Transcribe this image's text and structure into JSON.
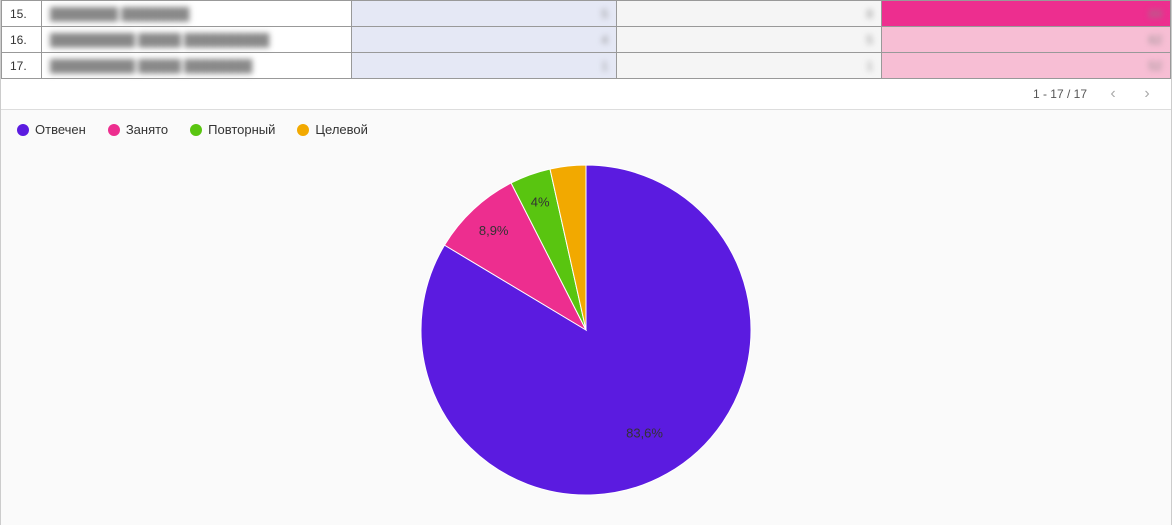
{
  "table": {
    "rows": [
      {
        "num": "15.",
        "name": "████████ ████████",
        "a": "5",
        "b": "8",
        "c": "89",
        "bright": true
      },
      {
        "num": "16.",
        "name": "██████████ █████ ██████████",
        "a": "4",
        "b": "5",
        "c": "62",
        "bright": false
      },
      {
        "num": "17.",
        "name": "██████████ █████ ████████",
        "a": "1",
        "b": "1",
        "c": "52",
        "bright": false
      }
    ]
  },
  "pagination": {
    "label": "1 - 17 / 17"
  },
  "legend": [
    {
      "label": "Отвечен",
      "color": "#5b1be0"
    },
    {
      "label": "Занято",
      "color": "#ed2e8f"
    },
    {
      "label": "Повторный",
      "color": "#59c510"
    },
    {
      "label": "Целевой",
      "color": "#f2a900"
    }
  ],
  "chart_data": {
    "type": "pie",
    "title": "",
    "series": [
      {
        "name": "Отвечен",
        "value": 83.6,
        "color": "#5b1be0",
        "label": "83,6%"
      },
      {
        "name": "Занято",
        "value": 8.9,
        "color": "#ed2e8f",
        "label": "8,9%"
      },
      {
        "name": "Повторный",
        "value": 4.0,
        "color": "#59c510",
        "label": "4%"
      },
      {
        "name": "Целевой",
        "value": 3.5,
        "color": "#f2a900",
        "label": ""
      }
    ]
  }
}
